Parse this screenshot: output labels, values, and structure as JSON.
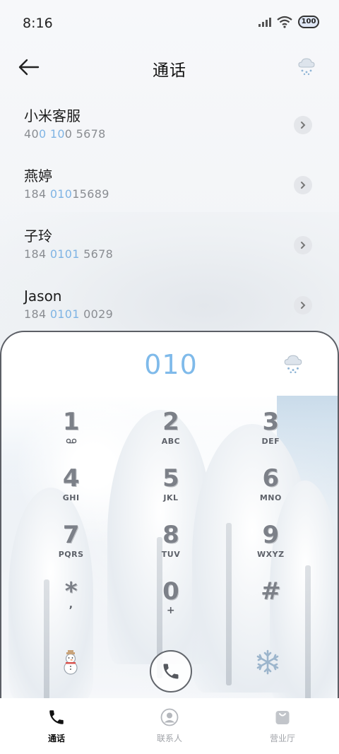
{
  "status_bar": {
    "time": "8:16",
    "battery": "100"
  },
  "header": {
    "title": "通话"
  },
  "call_log": [
    {
      "name": "小米客服",
      "number_parts": [
        "40",
        "0 10",
        "0 5678"
      ]
    },
    {
      "name": "燕婷",
      "number_parts": [
        "184 ",
        "010",
        "15689"
      ]
    },
    {
      "name": "子玲",
      "number_parts": [
        "184 ",
        "0101",
        " 5678"
      ]
    },
    {
      "name": "Jason",
      "number_parts": [
        "184 ",
        "0101",
        " 0029"
      ]
    }
  ],
  "dialer": {
    "dialed_number": "010",
    "keys": [
      {
        "digit": "1",
        "sub": ""
      },
      {
        "digit": "2",
        "sub": "ABC"
      },
      {
        "digit": "3",
        "sub": "DEF"
      },
      {
        "digit": "4",
        "sub": "GHI"
      },
      {
        "digit": "5",
        "sub": "JKL"
      },
      {
        "digit": "6",
        "sub": "MNO"
      },
      {
        "digit": "7",
        "sub": "PQRS"
      },
      {
        "digit": "8",
        "sub": "TUV"
      },
      {
        "digit": "9",
        "sub": "WXYZ"
      },
      {
        "digit": "*",
        "sub": ","
      },
      {
        "digit": "0",
        "sub": "+"
      },
      {
        "digit": "#",
        "sub": ""
      }
    ]
  },
  "bottom_nav": [
    {
      "label": "通话",
      "icon": "phone-icon",
      "active": true
    },
    {
      "label": "联系人",
      "icon": "contact-icon",
      "active": false
    },
    {
      "label": "营业厅",
      "icon": "shop-bag-icon",
      "active": false
    }
  ],
  "colors": {
    "accent": "#7fbaea",
    "highlight": "#7fb4e4"
  }
}
